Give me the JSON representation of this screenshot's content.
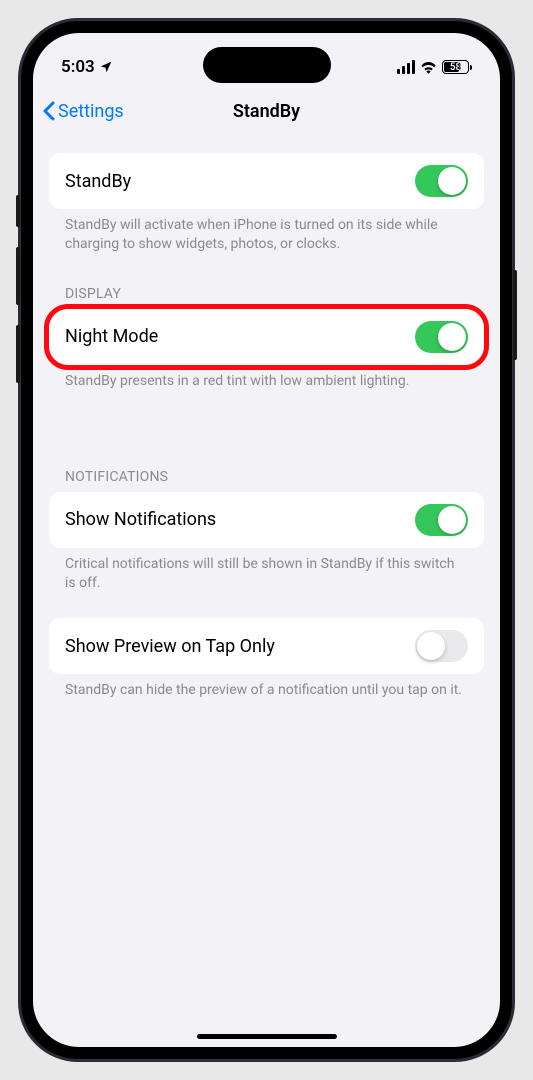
{
  "statusBar": {
    "time": "5:03",
    "battery": "58"
  },
  "nav": {
    "back": "Settings",
    "title": "StandBy"
  },
  "sections": {
    "standby": {
      "label": "StandBy",
      "toggled": true,
      "footer": "StandBy will activate when iPhone is turned on its side while charging to show widgets, photos, or clocks."
    },
    "display": {
      "header": "DISPLAY",
      "nightMode": {
        "label": "Night Mode",
        "toggled": true
      },
      "footer": "StandBy presents in a red tint with low ambient lighting."
    },
    "notifications": {
      "header": "NOTIFICATIONS",
      "showNotifications": {
        "label": "Show Notifications",
        "toggled": true
      },
      "footer": "Critical notifications will still be shown in StandBy if this switch is off."
    },
    "preview": {
      "label": "Show Preview on Tap Only",
      "toggled": false,
      "footer": "StandBy can hide the preview of a notification until you tap on it."
    }
  }
}
